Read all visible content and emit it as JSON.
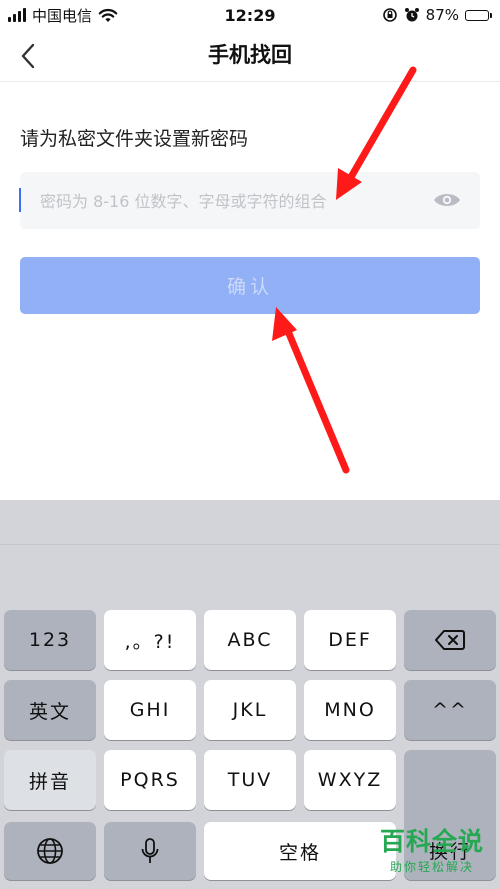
{
  "status_bar": {
    "carrier": "中国电信",
    "time": "12:29",
    "battery_percent": "87%",
    "battery_level": 0.87
  },
  "nav": {
    "title": "手机找回",
    "back_icon": "chevron-left-icon"
  },
  "content": {
    "prompt": "请为私密文件夹设置新密码",
    "password_placeholder": "密码为 8-16 位数字、字母或字符的组合",
    "password_value": "",
    "confirm_label": "确认"
  },
  "colors": {
    "accent": "#3f6ef0",
    "button_disabled": "#91b0f5",
    "annotation": "#ff1a1a",
    "watermark": "#26a852"
  },
  "keyboard": {
    "rows": [
      [
        "123",
        ",。?!",
        "ABC",
        "DEF",
        "delete"
      ],
      [
        "英文",
        "GHI",
        "JKL",
        "MNO",
        "^^"
      ],
      [
        "拼音",
        "PQRS",
        "TUV",
        "WXYZ",
        "换行"
      ],
      [
        "globe",
        "mic",
        "空格"
      ]
    ],
    "labels": {
      "num": "123",
      "punct": ",。?!",
      "abc": "ABC",
      "def": "DEF",
      "english": "英文",
      "ghi": "GHI",
      "jkl": "JKL",
      "mno": "MNO",
      "emoticon": "^^",
      "pinyin": "拼音",
      "pqrs": "PQRS",
      "tuv": "TUV",
      "wxyz": "WXYZ",
      "space": "空格",
      "return": "换行"
    }
  },
  "watermark": {
    "title": "百科全说",
    "subtitle": "助你轻松解决"
  }
}
